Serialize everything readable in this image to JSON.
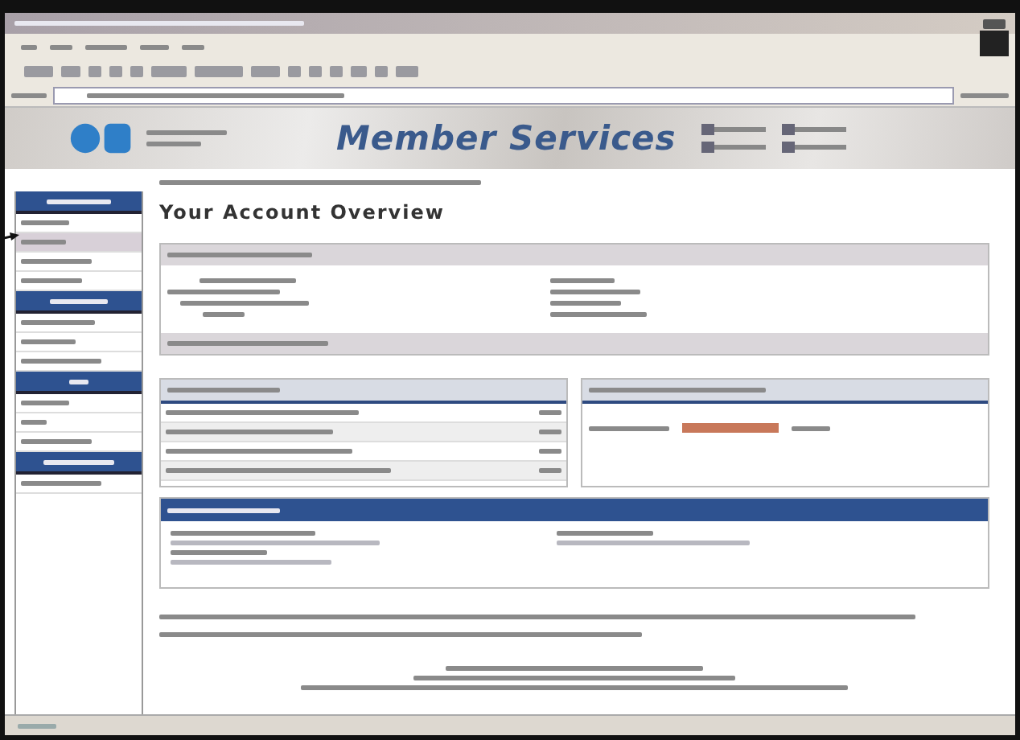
{
  "banner": {
    "title": "Member Services"
  },
  "sidebar": {
    "items": [
      {
        "selected": false
      },
      {
        "selected": true
      },
      {
        "selected": false
      },
      {
        "selected": false
      },
      {
        "selected": false
      },
      {
        "selected": false
      },
      {
        "selected": false
      },
      {
        "selected": false
      },
      {
        "selected": false
      },
      {
        "selected": false
      },
      {
        "selected": false
      }
    ]
  },
  "page": {
    "heading": "Your Account Overview"
  }
}
